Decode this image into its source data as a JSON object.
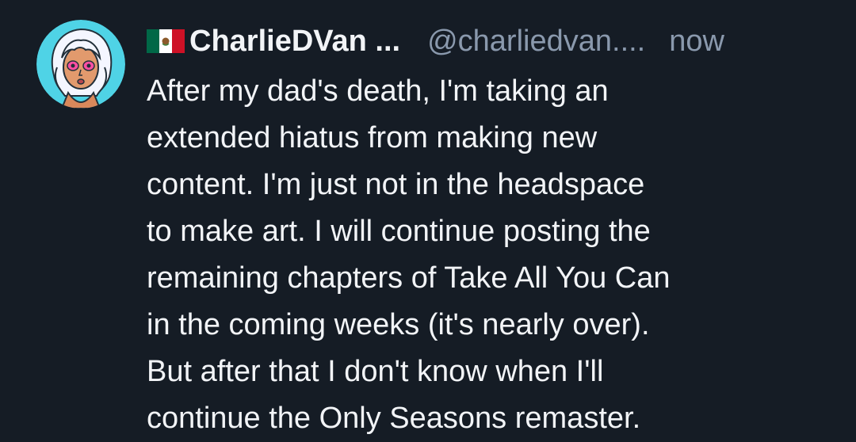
{
  "post": {
    "author": {
      "flag_icon": "mexico-flag-icon",
      "display_name": "CharlieDVan ...",
      "handle": "@charliedvan....",
      "avatar_icon": "cartoon-avatar-icon"
    },
    "timestamp": "now",
    "text_lines": [
      "After my dad's death, I'm taking an",
      "extended hiatus from making new",
      "content. I'm just not in the headspace",
      "to make art. I will continue posting the",
      "remaining chapters of Take All You Can",
      "in the coming weeks (it's nearly over).",
      "But after that I don't know when I'll",
      "continue the Only Seasons remaster."
    ]
  },
  "colors": {
    "background": "#151c25",
    "text_primary": "#f2f4f7",
    "text_secondary": "#8a99ad",
    "avatar_background": "#4fd3e6"
  }
}
